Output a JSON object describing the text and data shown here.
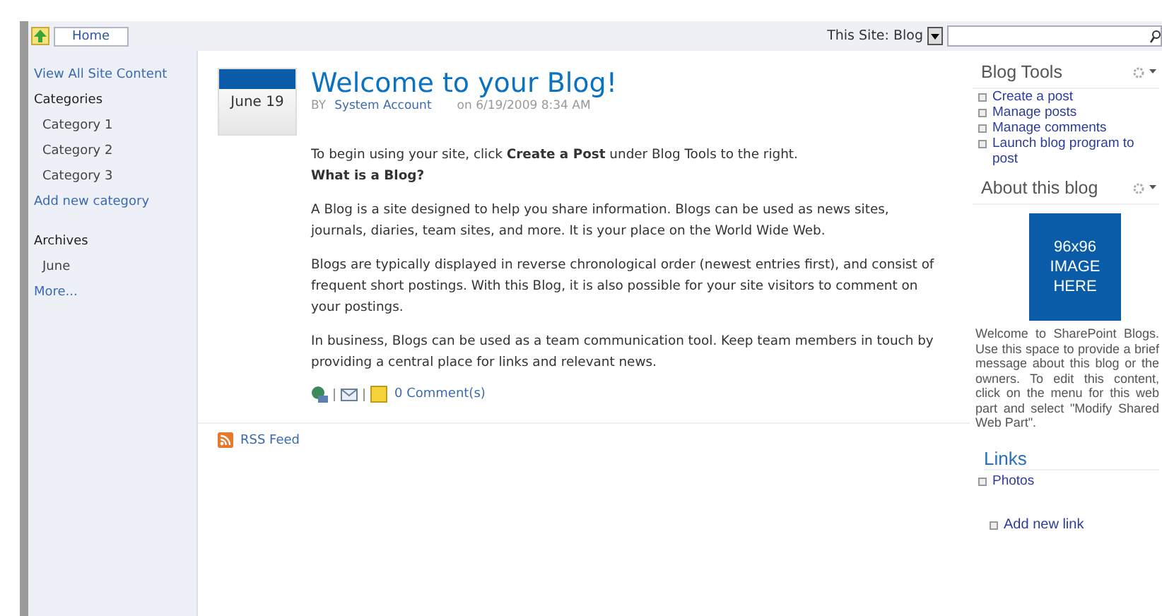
{
  "top_bar": {
    "home_button": "Home",
    "scope": "This Site: Blog"
  },
  "left_nav": [
    {
      "kind": "link",
      "label": "View All Site Content"
    },
    {
      "kind": "heading",
      "label": "Categories"
    },
    {
      "kind": "item",
      "label": "Category 1"
    },
    {
      "kind": "item",
      "label": "Category 2"
    },
    {
      "kind": "item",
      "label": "Category 3"
    },
    {
      "kind": "link",
      "label": "Add new category"
    },
    {
      "kind": "heading",
      "label": "Archives"
    },
    {
      "kind": "item",
      "label": "June"
    },
    {
      "kind": "link",
      "label": "More..."
    }
  ],
  "post": {
    "date": "June 19",
    "title": "Welcome to your Blog!",
    "by": "BY",
    "author": "System Account",
    "posted": "on 6/19/2009 8:34 AM",
    "paragraphs": [
      {
        "kind": "text",
        "text": "To begin using your site, click **Create a Post** under Blog Tools to the right."
      },
      {
        "kind": "heading",
        "text": "What is a Blog?"
      },
      {
        "kind": "text",
        "text": "A Blog is a site designed to help you share information. Blogs can be used as news sites, journals, diaries, team sites, and more. It is your place on the World Wide Web."
      },
      {
        "kind": "text",
        "text": "Blogs are typically displayed in reverse chronological order (newest entries first), and consist of frequent short postings. With this Blog, it is also possible for your site visitors to comment on your postings."
      },
      {
        "kind": "text",
        "text": "In business, Blogs can be used as a team communication tool. Keep team members in touch by providing a central place for links and relevant news."
      }
    ],
    "comments": "0 Comment(s)"
  },
  "rss": "RSS Feed",
  "blog_tools": {
    "title": "Blog Tools",
    "items": [
      "Create a post",
      "Manage posts",
      "Manage comments",
      "Launch blog program to post"
    ]
  },
  "about": {
    "title": "About this blog",
    "image_text": [
      "96x96",
      "IMAGE",
      "HERE"
    ],
    "text": "Welcome to SharePoint Blogs. Use this space to provide a brief message about this blog or the owners. To edit this content, click on the menu for this web part and select \"Modify Shared Web Part\"."
  },
  "links": {
    "title": "Links",
    "items": [
      "Photos"
    ],
    "add": "Add new link"
  }
}
